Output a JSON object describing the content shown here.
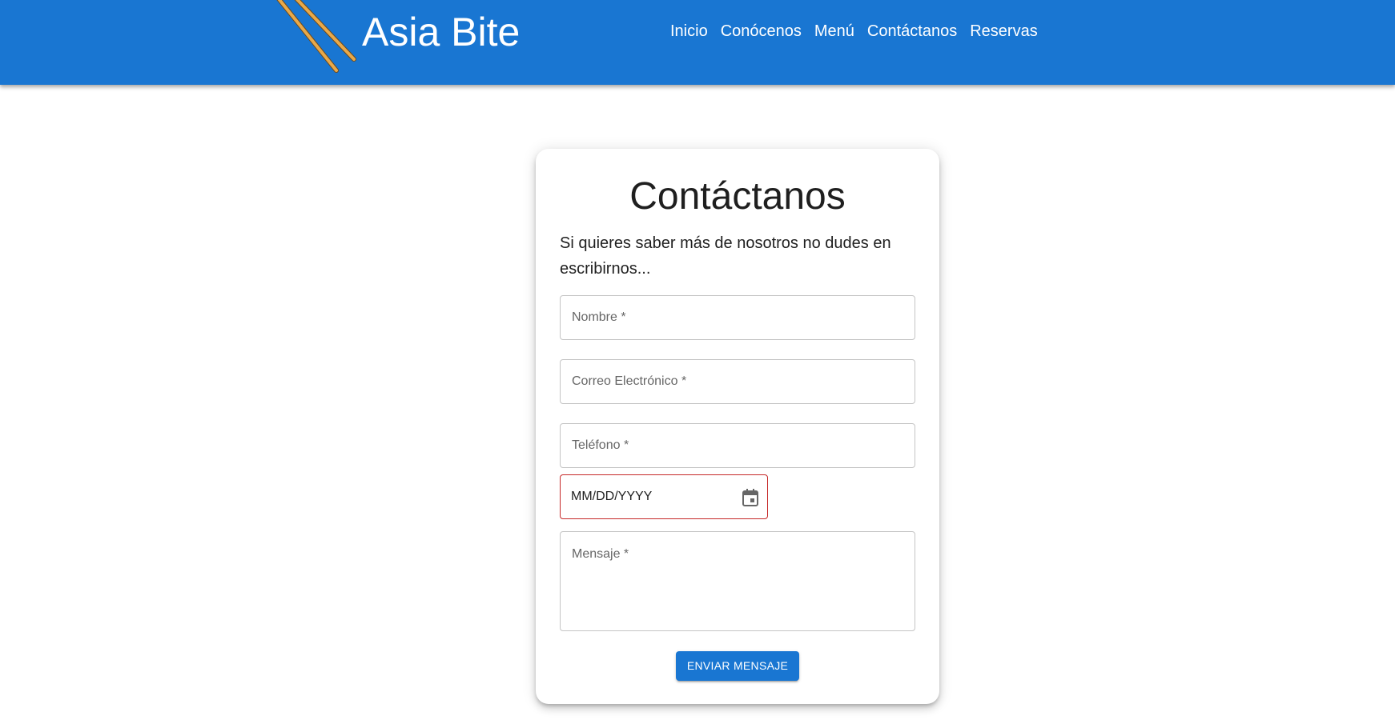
{
  "header": {
    "brand": "Asia Bite",
    "logo_icon": "chopsticks-icon",
    "nav": [
      "Inicio",
      "Conócenos",
      "Menú",
      "Contáctanos",
      "Reservas"
    ]
  },
  "contact_form": {
    "title": "Contáctanos",
    "subtitle": "Si quieres saber más de nosotros no dudes en escribirnos...",
    "fields": {
      "name_label": "Nombre *",
      "email_label": "Correo Electrónico *",
      "phone_label": "Teléfono *",
      "date_value": "MM/DD/YYYY",
      "message_label": "Mensaje *"
    },
    "calendar_icon": "calendar-icon",
    "submit_label": "ENVIAR MENSAJE"
  },
  "colors": {
    "primary": "#1976d2",
    "error_border": "#c62828"
  }
}
